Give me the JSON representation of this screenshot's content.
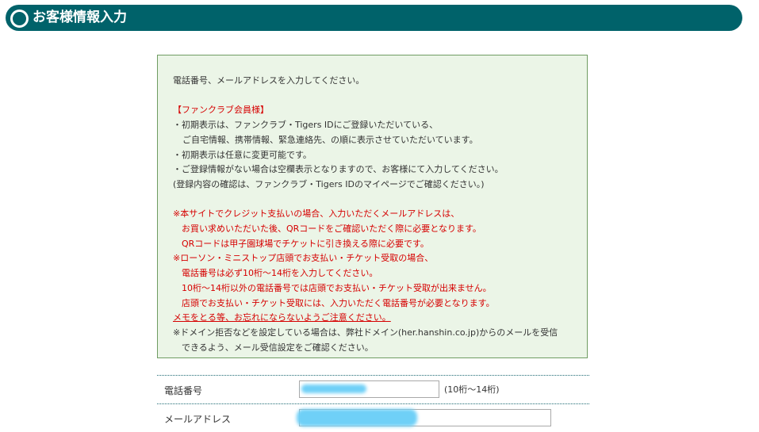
{
  "header": {
    "title": "お客様情報入力",
    "icon": "circle-icon"
  },
  "notice": {
    "intro": "電話番号、メールアドレスを入力してください。",
    "fanclub_heading": "【ファンクラブ会員様】",
    "fanclub_lines": [
      "・初期表示は、ファンクラブ・Tigers IDにご登録いただいている、",
      "ご自宅情報、携帯情報、緊急連絡先、の順に表示させていただいています。",
      "・初期表示は任意に変更可能です。",
      "・ご登録情報がない場合は空欄表示となりますので、お客様にて入力してください。",
      "(登録内容の確認は、ファンクラブ・Tigers IDのマイページでご確認ください。)"
    ],
    "credit_line1": "※本サイトでクレジット支払いの場合、入力いただくメールアドレスは、",
    "credit_line2": "お買い求めいただいた後、QRコードをご確認いただく際に必要となります。",
    "credit_line3": "QRコードは甲子園球場でチケットに引き換える際に必要です。",
    "store_line1": "※ローソン・ミニストップ店頭でお支払い・チケット受取の場合、",
    "store_line2": "電話番号は必ず10桁～14桁を入力してください。",
    "store_line3": "10桁～14桁以外の電話番号では店頭でお支払い・チケット受取が出来ません。",
    "store_line4": "店頭でお支払い・チケット受取には、入力いただく電話番号が必要となります。",
    "memo_line": "メモをとる等、お忘れにならないようご注意ください。",
    "domain_line1": "※ドメイン拒否などを設定している場合は、弊社ドメイン(her.hanshin.co.jp)からのメールを受信",
    "domain_line2": "できるよう、メール受信設定をご確認ください。"
  },
  "form": {
    "phone_label": "電話番号",
    "phone_hint": "(10桁～14桁)",
    "email_label": "メールアドレス"
  },
  "colors": {
    "header_bg": "#00626a",
    "notice_bg": "#ebf5e7",
    "notice_border": "#6f9c62",
    "warning_red": "#d60000",
    "redaction_blue": "#6fd0f7"
  }
}
